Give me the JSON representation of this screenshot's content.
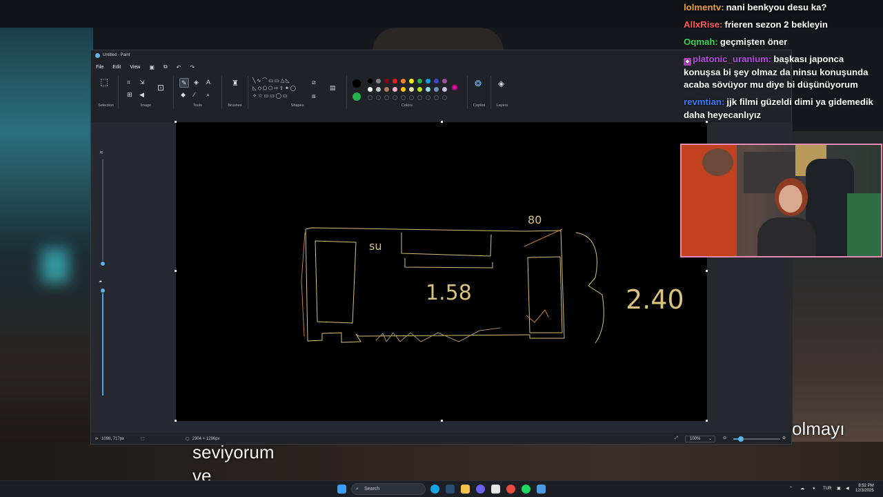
{
  "chat": {
    "messages": [
      {
        "user": "lolmentv:",
        "user_color": "#e8a33d",
        "text": "nani benkyou desu ka?"
      },
      {
        "user": "AllxRise:",
        "user_color": "#ff5a5f",
        "text": "frieren sezon 2 bekleyin"
      },
      {
        "user": "Oqmah:",
        "user_color": "#38d45a",
        "text": "geçmişten öner"
      },
      {
        "user": "platonic_uranium:",
        "user_color": "#b74be3",
        "text": "başkası japonca konuşsa bi şey olmaz da ninsu konuşunda acaba sövüyor mu diye bi düşünüyorum"
      },
      {
        "user": "revmtian:",
        "user_color": "#3e7cf2",
        "text": "jjk filmi güzeldi dimi ya gidemedik daha heyecanlıyız"
      }
    ]
  },
  "paint": {
    "title": "Untitled - Paint",
    "menu": [
      "File",
      "Edit",
      "View"
    ],
    "groups": {
      "selection": "Selection",
      "image": "Image",
      "tools": "Tools",
      "brushes": "Brushes",
      "shapes": "Shapes",
      "colors": "Colors",
      "copilot": "Copilot",
      "layers": "Layers"
    },
    "palette": [
      "#000000",
      "#7f7f7f",
      "#880015",
      "#ed1c24",
      "#ff7f27",
      "#fff200",
      "#22b14c",
      "#00a2e8",
      "#3f48cc",
      "#a349a4",
      "#ffffff",
      "#c3c3c3",
      "#b97a57",
      "#ffaec9",
      "#ffc90e",
      "#efe4b0",
      "#b5e61d",
      "#99d9ea",
      "#7092be",
      "#c8bfe7"
    ],
    "primary_color": "#000000",
    "secondary_color": "#22b14c",
    "status": {
      "cursor_pos": "1098, 717px",
      "canvas_size": "2304 × 1296px",
      "zoom": "100%"
    }
  },
  "drawing": {
    "labels": [
      "su",
      "1.58",
      "2.40",
      "80"
    ]
  },
  "subtitles": {
    "left_line1": "seviyorum",
    "left_line2": "ve",
    "right_line": "olmayı"
  },
  "taskbar": {
    "search_placeholder": "Search",
    "language": "TUR",
    "time": "8:52 PM",
    "date": "12/3/2025"
  }
}
